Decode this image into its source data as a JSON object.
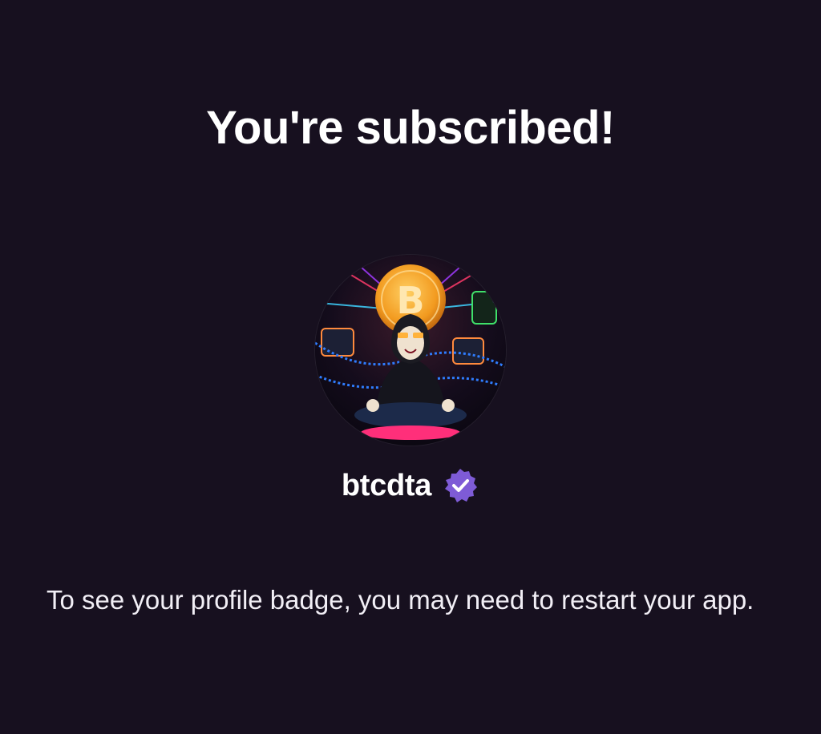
{
  "header": {
    "title": "You're subscribed!"
  },
  "profile": {
    "username": "btcdta",
    "avatar_icon": "bitcoin-meditating-hacker-avatar",
    "verified_icon": "verified-badge-icon",
    "verified_color": "#7e5bd6"
  },
  "body": {
    "message": "To see your profile badge, you may need to restart your app."
  },
  "colors": {
    "background": "#17101f",
    "text": "#ffffff"
  }
}
